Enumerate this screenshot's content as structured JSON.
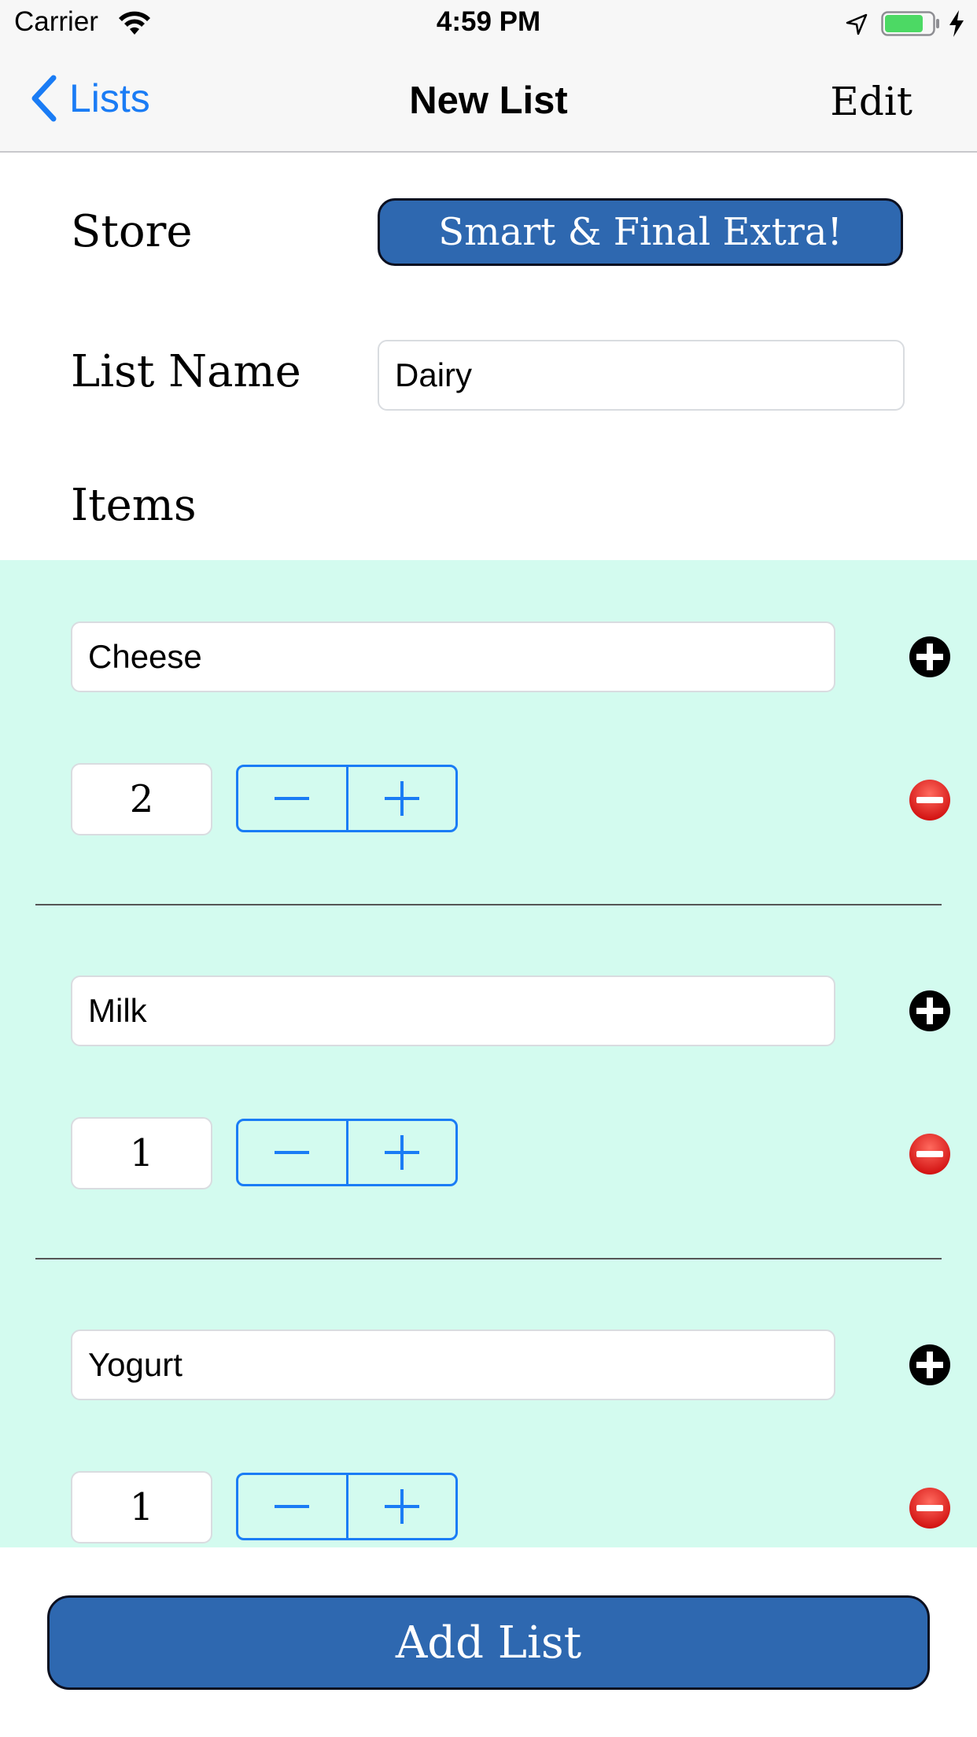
{
  "status_bar": {
    "carrier": "Carrier",
    "time": "4:59 PM",
    "battery_color": "#4cd964"
  },
  "nav": {
    "back_label": "Lists",
    "title": "New List",
    "edit_label": "Edit"
  },
  "form": {
    "store_label": "Store",
    "store_value": "Smart & Final Extra!",
    "list_name_label": "List Name",
    "list_name_value": "Dairy",
    "items_label": "Items"
  },
  "items": [
    {
      "name": "Cheese",
      "quantity": "2"
    },
    {
      "name": "Milk",
      "quantity": "1"
    },
    {
      "name": "Yogurt",
      "quantity": "1"
    }
  ],
  "actions": {
    "add_list_label": "Add List"
  },
  "colors": {
    "accent": "#1a7cf5",
    "button_fill": "#2e68b0",
    "items_background": "#d3fbef",
    "remove_icon": "#e8201f"
  },
  "icons": {
    "add_item": "plus-circle-icon",
    "remove_item": "minus-circle-icon",
    "stepper_decrement": "minus-icon",
    "stepper_increment": "plus-icon"
  }
}
